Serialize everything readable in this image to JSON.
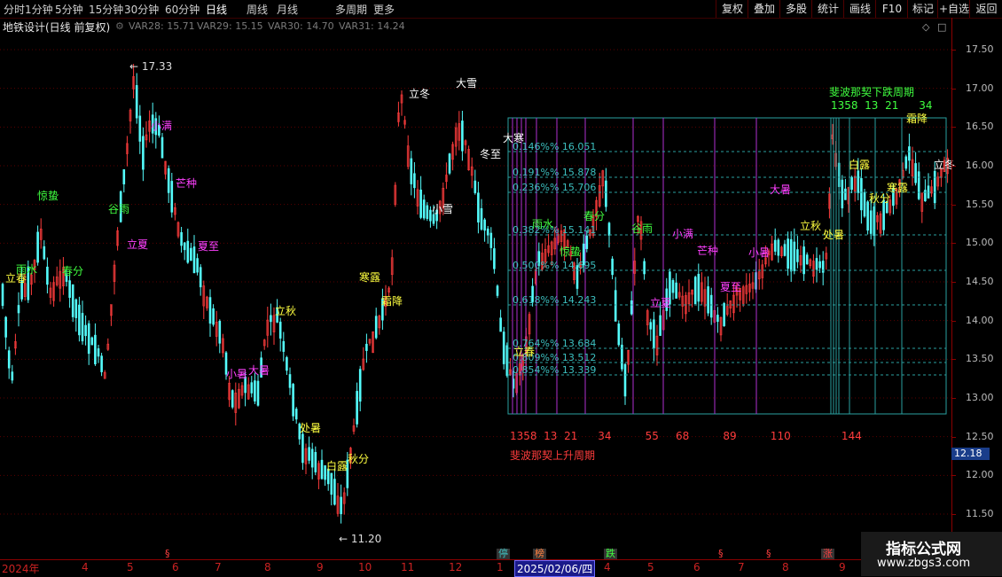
{
  "toolbar": {
    "periods": [
      "分时",
      "1分钟",
      "5分钟",
      "15分钟",
      "30分钟",
      "60分钟",
      "日线",
      "周线",
      "月线",
      "多周期",
      "更多"
    ],
    "active": "日线",
    "right_buttons": [
      "复权",
      "叠加",
      "多股",
      "统计",
      "画线",
      "F10",
      "标记",
      "+自选",
      "返回"
    ]
  },
  "info": {
    "title": "地铁设计(日线 前复权)",
    "vars": [
      "VAR28: 15.71",
      "VAR29: 15.15",
      "VAR30: 14.70",
      "VAR31: 14.24"
    ]
  },
  "price_axis": [
    "17.50",
    "17.00",
    "16.50",
    "16.00",
    "15.50",
    "15.00",
    "14.50",
    "14.00",
    "13.50",
    "13.00",
    "12.50",
    "12.00",
    "11.50"
  ],
  "current_price": "12.18",
  "high_marker": "17.33",
  "low_marker": "11.20",
  "date_axis": {
    "labels": [
      "2024年",
      "4",
      "5",
      "6",
      "7",
      "8",
      "9",
      "10",
      "11",
      "12",
      "1",
      "2025/02/06/四",
      "4",
      "5",
      "6",
      "7",
      "8",
      "9"
    ],
    "cursor": "2025/02/06/四",
    "marks": [
      {
        "text": "§",
        "color": "#ff4040"
      },
      {
        "text": "停",
        "color": "#40c0c0"
      },
      {
        "text": "榜",
        "color": "#ff8040"
      },
      {
        "text": "跌",
        "color": "#40ff40"
      },
      {
        "text": "§",
        "color": "#ff4040"
      },
      {
        "text": "§",
        "color": "#ff4040"
      },
      {
        "text": "涨",
        "color": "#ff4040"
      }
    ]
  },
  "fib": {
    "up_title": "斐波那契上升周期",
    "up_numbers": "1358  13  21      34          55     68          89          110               144",
    "down_title": "斐波那契下跌周期",
    "down_numbers": "1358  13  21      34",
    "levels": [
      "0.146%% 16.051",
      "0.191%% 15.878",
      "0.236%% 15.706",
      "0.382%% 15.141",
      "0.500%% 14.695",
      "0.618%% 14.243",
      "0.764%% 13.684",
      "0.809%% 13.512",
      "0.854%% 13.339"
    ]
  },
  "solar_terms": [
    {
      "t": "立春",
      "c": "#ffff40"
    },
    {
      "t": "雨水",
      "c": "#40ff40"
    },
    {
      "t": "惊蛰",
      "c": "#40ff40"
    },
    {
      "t": "春分",
      "c": "#40ff40"
    },
    {
      "t": "谷雨",
      "c": "#40ff40"
    },
    {
      "t": "立夏",
      "c": "#ff40ff"
    },
    {
      "t": "小满",
      "c": "#ff40ff"
    },
    {
      "t": "芒种",
      "c": "#ff40ff"
    },
    {
      "t": "夏至",
      "c": "#ff40ff"
    },
    {
      "t": "小暑",
      "c": "#ff40ff"
    },
    {
      "t": "大暑",
      "c": "#ff40ff"
    },
    {
      "t": "立秋",
      "c": "#ffff40"
    },
    {
      "t": "处暑",
      "c": "#ffff40"
    },
    {
      "t": "白露",
      "c": "#ffff40"
    },
    {
      "t": "秋分",
      "c": "#ffff40"
    },
    {
      "t": "寒露",
      "c": "#ffff40"
    },
    {
      "t": "霜降",
      "c": "#ffff40"
    },
    {
      "t": "立冬",
      "c": "#ffffff"
    },
    {
      "t": "大雪",
      "c": "#ffffff"
    },
    {
      "t": "大寒",
      "c": "#ffffff"
    },
    {
      "t": "冬至",
      "c": "#ffffff"
    },
    {
      "t": "小雪",
      "c": "#ffffff"
    },
    {
      "t": "雨水",
      "c": "#40ff40"
    },
    {
      "t": "惊蛰",
      "c": "#40ff40"
    },
    {
      "t": "春分",
      "c": "#40ff40"
    },
    {
      "t": "谷雨",
      "c": "#40ff40"
    },
    {
      "t": "立春",
      "c": "#ffff40"
    },
    {
      "t": "立夏",
      "c": "#ff40ff"
    },
    {
      "t": "小满",
      "c": "#ff40ff"
    },
    {
      "t": "芒种",
      "c": "#ff40ff"
    },
    {
      "t": "夏至",
      "c": "#ff40ff"
    },
    {
      "t": "小暑",
      "c": "#ff40ff"
    },
    {
      "t": "大暑",
      "c": "#ff40ff"
    },
    {
      "t": "立秋",
      "c": "#ffff40"
    },
    {
      "t": "处暑",
      "c": "#ffff40"
    },
    {
      "t": "白露",
      "c": "#ffff40"
    },
    {
      "t": "秋分",
      "c": "#ffff40"
    },
    {
      "t": "寒露",
      "c": "#ffff40"
    },
    {
      "t": "霜降",
      "c": "#ffff40"
    },
    {
      "t": "立冬",
      "c": "#ffffff"
    }
  ],
  "watermark": {
    "line1": "指标公式网",
    "line2": "www.zbgs3.com"
  },
  "colors": {
    "up": "#ff3c3c",
    "down": "#54fcfc",
    "grid": "#8a0000",
    "fib_line": "#2aa0a0",
    "cycle": "#c040c0"
  }
}
